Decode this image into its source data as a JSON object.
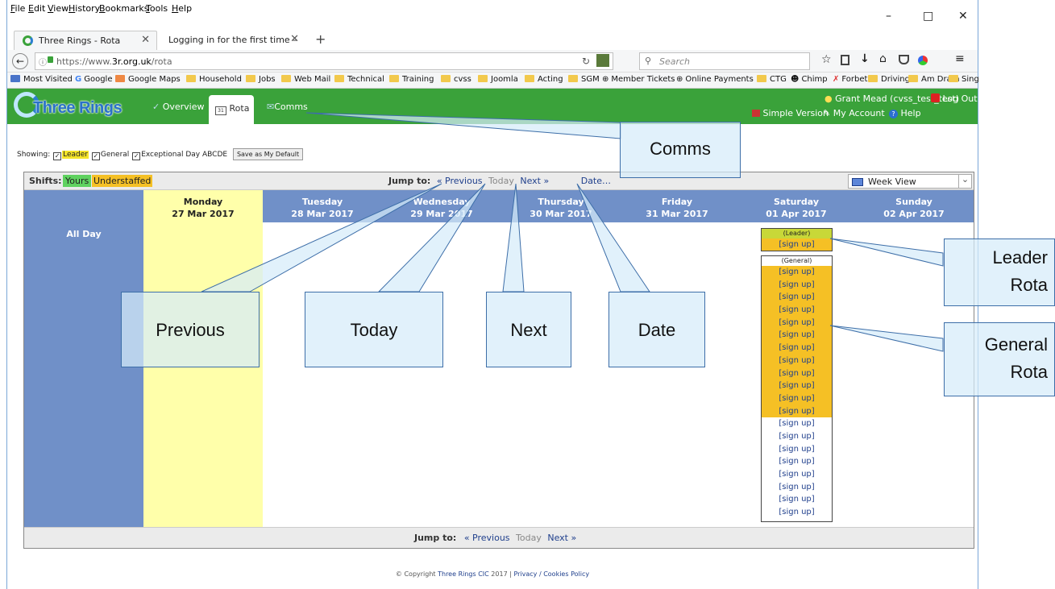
{
  "browser": {
    "menu": [
      "File",
      "Edit",
      "View",
      "History",
      "Bookmarks",
      "Tools",
      "Help"
    ],
    "window_controls": [
      "–",
      "□",
      "✕"
    ],
    "tabs": [
      {
        "title": "Three Rings - Rota",
        "active": true
      },
      {
        "title": "Logging in for the first time – ...",
        "active": false
      }
    ],
    "new_tab": "+",
    "url_prefix": "https://www.",
    "url_domain": "3r.org.uk",
    "url_path": "/rota",
    "search_placeholder": "Search",
    "bookmarks": [
      "Most Visited",
      "Google",
      "Google Maps",
      "Household",
      "Jobs",
      "Web Mail",
      "Technical",
      "Training",
      "cvss",
      "Joomla",
      "Acting",
      "SGM",
      "Member Tickets",
      "Online Payments",
      "CTG",
      "Chimp",
      "Forbet",
      "Driving",
      "Am Dram",
      "Sing"
    ]
  },
  "site": {
    "logo_text": "Three Rings",
    "nav": [
      {
        "label": "Overview"
      },
      {
        "label": "Rota",
        "active": true
      },
      {
        "label": "Comms"
      }
    ],
    "user": "Grant Mead (cvss_test_test)",
    "logout": "Log Out",
    "simple_version": "Simple Version",
    "my_account": "My Account",
    "help": "Help"
  },
  "filters": {
    "showing_label": "Showing:",
    "leader": "Leader",
    "general": "General",
    "exceptional": "Exceptional Day ABCDE",
    "save_default": "Save as My Default"
  },
  "shifts": {
    "label": "Shifts:",
    "yours": "Yours",
    "understaffed": "Understaffed"
  },
  "jump": {
    "label": "Jump to:",
    "previous": "« Previous",
    "today": "Today",
    "next": "Next »",
    "date": "Date…"
  },
  "view_select": "Week View",
  "days": [
    {
      "name": "Monday",
      "date": "27 Mar 2017",
      "today": true
    },
    {
      "name": "Tuesday",
      "date": "28 Mar 2017"
    },
    {
      "name": "Wednesday",
      "date": "29 Mar 2017"
    },
    {
      "name": "Thursday",
      "date": "30 Mar 2017"
    },
    {
      "name": "Friday",
      "date": "31 Mar 2017"
    },
    {
      "name": "Saturday",
      "date": "01 Apr 2017"
    },
    {
      "name": "Sunday",
      "date": "02 Apr 2017"
    }
  ],
  "all_day": "All Day",
  "leader_rota": {
    "heading": "(Leader)",
    "slots": [
      "[sign up]"
    ]
  },
  "general_rota": {
    "heading": "(General)",
    "understaffed_count": 12,
    "slots": [
      "[sign up]",
      "[sign up]",
      "[sign up]",
      "[sign up]",
      "[sign up]",
      "[sign up]",
      "[sign up]",
      "[sign up]",
      "[sign up]",
      "[sign up]",
      "[sign up]",
      "[sign up]",
      "[sign up]",
      "[sign up]",
      "[sign up]",
      "[sign up]",
      "[sign up]",
      "[sign up]",
      "[sign up]",
      "[sign up]"
    ]
  },
  "footer": {
    "copyright": "© Copyright",
    "org": "Three Rings CIC",
    "year": "2017 |",
    "privacy": "Privacy / Cookies Policy"
  },
  "callouts": {
    "comms": "Comms",
    "previous": "Previous",
    "today": "Today",
    "next": "Next",
    "date": "Date",
    "leader_rota": [
      "Leader",
      "Rota"
    ],
    "general_rota": [
      "General",
      "Rota"
    ]
  },
  "colors": {
    "header_green": "#3aa23a",
    "day_header_blue": "#7090c8",
    "today_yellow": "#ffffaa",
    "understaffed": "#f5c025",
    "yours": "#5fd25f"
  }
}
